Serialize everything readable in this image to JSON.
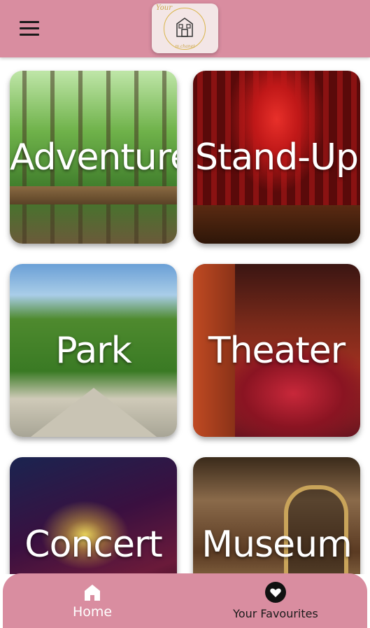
{
  "header": {
    "menu_icon": "hamburger-menu-icon",
    "logo": {
      "top_text": "Your",
      "bottom_text": "m.chanet",
      "icon": "house-icon"
    }
  },
  "categories": [
    {
      "label": "Adventure"
    },
    {
      "label": "Stand-Up"
    },
    {
      "label": "Park"
    },
    {
      "label": "Theater"
    },
    {
      "label": "Concert"
    },
    {
      "label": "Museum"
    }
  ],
  "bottom_nav": {
    "home": {
      "label": "Home",
      "icon": "home-icon"
    },
    "favourites": {
      "label": "Your Favourites",
      "icon": "heart-icon"
    }
  },
  "colors": {
    "accent": "#d98da0",
    "label_text": "#ffffff"
  }
}
